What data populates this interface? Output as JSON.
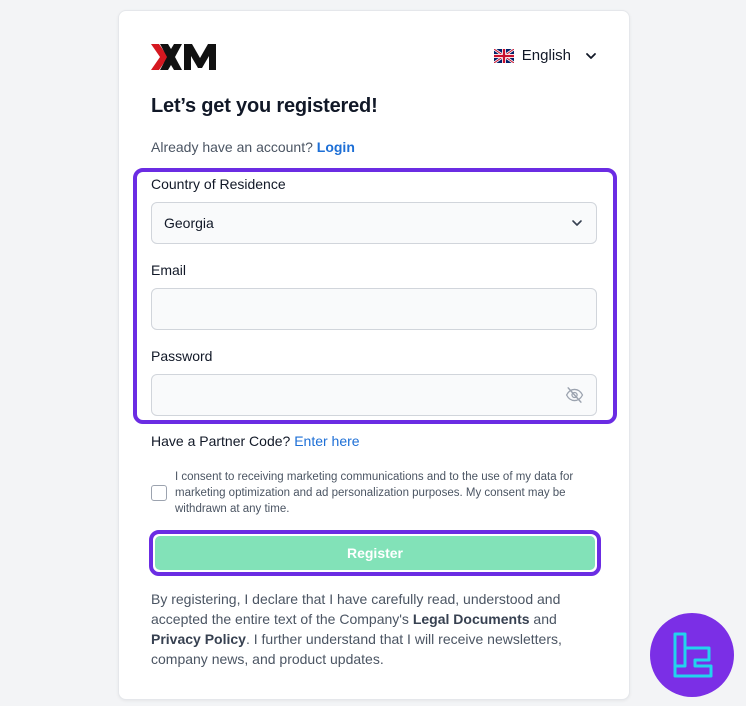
{
  "brand": {
    "logo_text": "XM"
  },
  "language": {
    "selected": "English",
    "flag_icon": "uk-flag-icon"
  },
  "header": {
    "title": "Let’s get you registered!"
  },
  "login": {
    "prompt": "Already have an account?",
    "link": "Login"
  },
  "form": {
    "country": {
      "label": "Country of Residence",
      "value": "Georgia"
    },
    "email": {
      "label": "Email",
      "value": "",
      "placeholder": ""
    },
    "password": {
      "label": "Password",
      "value": "",
      "placeholder": ""
    }
  },
  "partner": {
    "prompt": "Have a Partner Code?",
    "link": "Enter here"
  },
  "consent": {
    "text": "I consent to receiving marketing communications and to the use of my data for marketing optimization and ad personalization purposes. My consent may be withdrawn at any time.",
    "checked": false
  },
  "register": {
    "label": "Register"
  },
  "legal": {
    "part1": "By registering, I declare that I have carefully read, understood and accepted the entire text of the Company's ",
    "legal_documents": "Legal Documents",
    "part2": " and ",
    "privacy_policy": "Privacy Policy",
    "part3": ". I further understand that I will receive newsletters, company news, and product updates."
  },
  "colors": {
    "accent": "#6b2ce3",
    "link": "#1d6fd6",
    "register_button": "#82e2b8",
    "logo_red": "#d51820",
    "badge": "#7b2fe6"
  }
}
